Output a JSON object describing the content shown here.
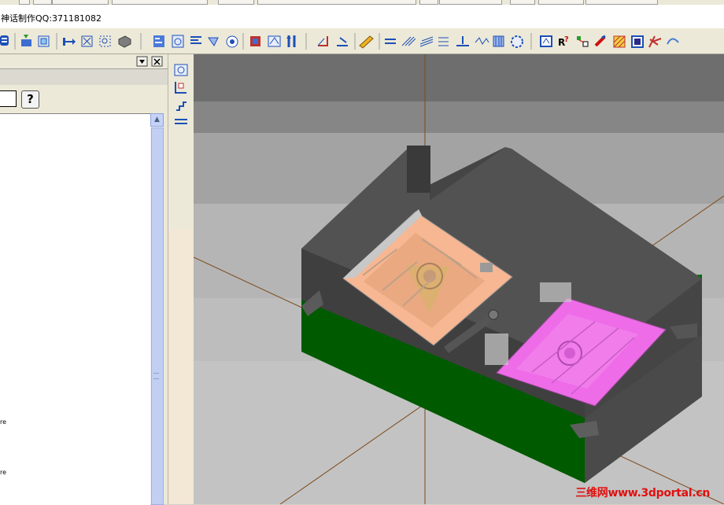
{
  "window": {
    "title": "神话制作QQ:371181082"
  },
  "toolbar": {
    "icons": [
      "surface-icon",
      "import-icon",
      "layer-icon",
      "join-icon",
      "fit-icon",
      "zoom-window-icon",
      "solid-icon",
      "pattern-icon",
      "settings-icon",
      "list-icon",
      "rotate-icon",
      "target-icon",
      "mold-base-icon",
      "view-icon",
      "split-icon",
      "draft-icon",
      "dimension-icon",
      "pencil-icon",
      "line-icon",
      "hatch-icon",
      "hatch-2-icon",
      "offset-icon",
      "base-icon",
      "wave-icon",
      "grid-icon",
      "gear-icon",
      "book-icon",
      "reference-icon",
      "analyze-icon",
      "probe-icon",
      "mesh-icon",
      "box-icon",
      "fork-icon",
      "curve-icon"
    ]
  },
  "left_panel": {
    "help_label": "?",
    "tree_labels": [
      "re",
      "re"
    ]
  },
  "viewport": {
    "background_colors": [
      "#6b6b6b",
      "#8a8a8a",
      "#a1a1a1",
      "#c8c8c8"
    ],
    "mold_plate_color": "#006d00",
    "core_color": "#444444",
    "cavity_insert_color": "#f6b792",
    "core_insert_color": "#ee6ce8",
    "axis_color": "#7d4a1c"
  },
  "watermark": {
    "text": "三维网www.3dportal.cn"
  }
}
